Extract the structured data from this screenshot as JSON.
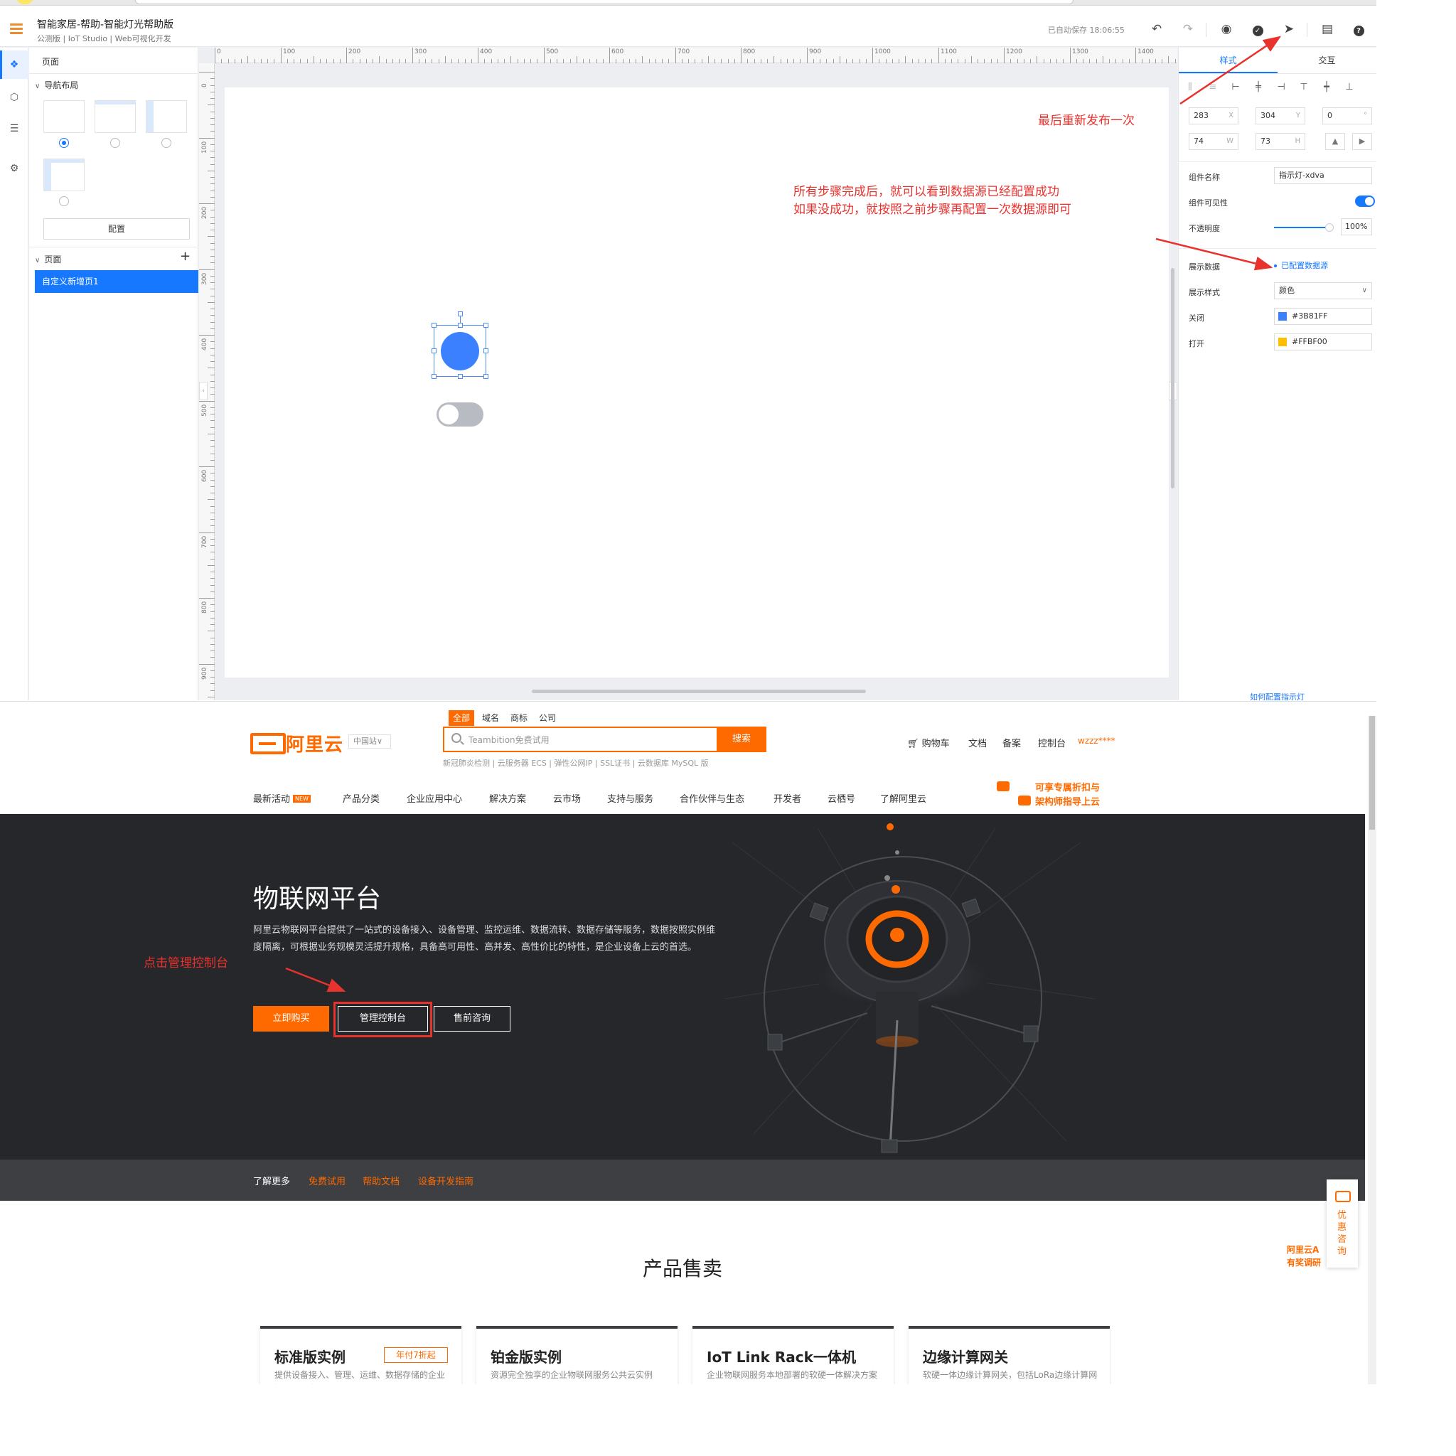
{
  "editor": {
    "title": "智能家居-帮助-智能灯光帮助版",
    "subtitle": "公测版 | IoT Studio | Web可视化开发",
    "autosave": "已自动保存 18:06:55",
    "toolbar_icons": [
      "undo-icon",
      "redo-icon",
      "preview-eye-icon",
      "check-icon",
      "publish-send-icon",
      "doc-icon",
      "help-icon"
    ],
    "left_panel": {
      "title": "页面",
      "nav_layout_label": "导航布局",
      "config_button": "配置",
      "pages_label": "页面",
      "add_icon": "+",
      "page_item": "自定义新增页1"
    },
    "ruler_h": [
      "0",
      "100",
      "200",
      "300",
      "400",
      "500",
      "600",
      "700",
      "800",
      "900",
      "1000",
      "1100",
      "1200",
      "1300",
      "1400"
    ],
    "ruler_v": [
      "0",
      "100",
      "200",
      "300",
      "400",
      "500",
      "600",
      "700",
      "800",
      "900"
    ],
    "right_panel": {
      "tab_style": "样式",
      "tab_interact": "交互",
      "x": "283",
      "x_suffix": "X",
      "y": "304",
      "y_suffix": "Y",
      "rotation": "0",
      "rotation_suffix": "°",
      "w": "74",
      "w_suffix": "W",
      "h": "73",
      "h_suffix": "H",
      "name_label": "组件名称",
      "name_value": "指示灯-xdva",
      "visible_label": "组件可见性",
      "visible": true,
      "opacity_label": "不透明度",
      "opacity_value": "100%",
      "data_label": "展示数据",
      "data_link": "已配置数据源",
      "style_label": "展示样式",
      "style_value": "颜色",
      "off_label": "关闭",
      "off_color": "#3B81FF",
      "on_label": "打开",
      "on_color": "#FFBF00",
      "help_link": "如何配置指示灯"
    }
  },
  "annotations": {
    "republish": "最后重新发布一次",
    "success_line1": "所有步骤完成后，就可以看到数据源已经配置成功",
    "success_line2": "如果没成功，就按照之前步骤再配置一次数据源即可",
    "click_console": "点击管理控制台"
  },
  "aliyun": {
    "logo_text": "阿里云",
    "site_select": "中国站∨",
    "search_tabs": [
      "全部",
      "域名",
      "商标",
      "公司"
    ],
    "search_placeholder": "Teambition免费试用",
    "search_button": "搜索",
    "hot_words": "新冠肺炎检测 | 云服务器 ECS | 弹性公网IP | SSL证书 | 云数据库 MySQL 版",
    "header_links": [
      "购物车",
      "文档",
      "备案",
      "控制台"
    ],
    "user": "wzzz****",
    "nav": [
      "最新活动",
      "产品分类",
      "企业应用中心",
      "解决方案",
      "云市场",
      "支持与服务",
      "合作伙伴与生态",
      "开发者",
      "云栖号",
      "了解阿里云"
    ],
    "nav_new_badge": "NEW",
    "promo_line1": "可享专属折扣与",
    "promo_line2": "架构师指导上云",
    "hero_title": "物联网平台",
    "hero_desc": "阿里云物联网平台提供了一站式的设备接入、设备管理、监控运维、数据流转、数据存储等服务，数据按照实例维度隔离，可根据业务规模灵活提升规格，具备高可用性、高并发、高性价比的特性，是企业设备上云的首选。",
    "btn_buy": "立即购买",
    "btn_console": "管理控制台",
    "btn_consult": "售前咨询",
    "learn_more": "了解更多",
    "learn_links": [
      "免费试用",
      "帮助文档",
      "设备开发指南"
    ],
    "products_title": "产品售卖",
    "cards": [
      {
        "title": "标准版实例",
        "badge": "年付7折起",
        "desc": "提供设备接入、管理、运维、数据存储的企业物联网服务"
      },
      {
        "title": "铂金版实例",
        "badge": "",
        "desc": "资源完全独享的企业物联网服务公共云实例"
      },
      {
        "title": "IoT Link Rack一体机",
        "badge": "",
        "desc": "企业物联网服务本地部署的软硬一体解决方案"
      },
      {
        "title": "边缘计算网关",
        "badge": "",
        "desc": "软硬一体边缘计算网关，包括LoRa边缘计算网关"
      }
    ],
    "float_consult": "优惠咨询",
    "float_tag_line1": "阿里云A",
    "float_tag_line2": "有奖调研"
  }
}
